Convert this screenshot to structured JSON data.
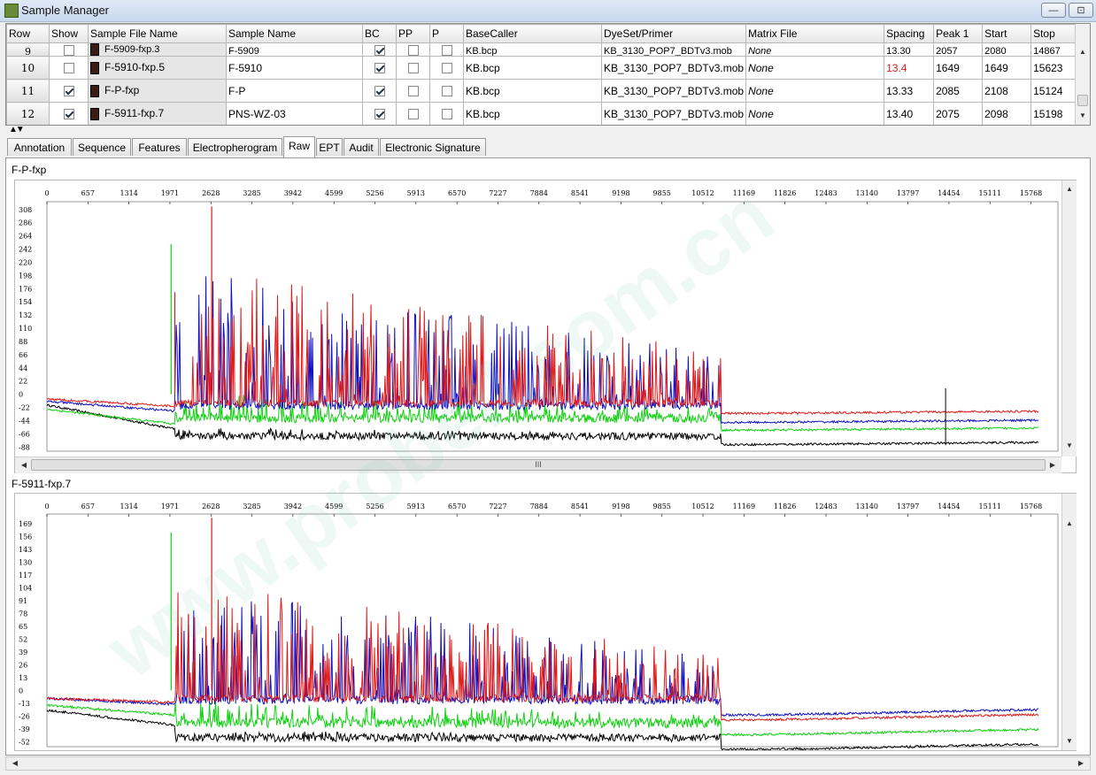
{
  "window": {
    "title": "Sample Manager",
    "min_glyph": "—",
    "max_glyph": "⊡"
  },
  "grid": {
    "headers": [
      "Row",
      "Show",
      "Sample File Name",
      "Sample Name",
      "BC",
      "PP",
      "P",
      "BaseCaller",
      "DyeSet/Primer",
      "Matrix File",
      "Spacing",
      "Peak 1",
      "Start",
      "Stop"
    ],
    "rows": [
      {
        "row": "9",
        "show": false,
        "file": "F-5909-fxp.3",
        "sample": "F-5909",
        "bc": true,
        "pp": false,
        "p": false,
        "basecaller": "KB.bcp",
        "dyeset": "KB_3130_POP7_BDTv3.mob",
        "matrix": "None",
        "spacing": "13.30",
        "spacing_color": "#000000",
        "peak1": "2057",
        "start": "2080",
        "stop": "14867"
      },
      {
        "row": "10",
        "show": false,
        "file": "F-5910-fxp.5",
        "sample": "F-5910",
        "bc": true,
        "pp": false,
        "p": false,
        "basecaller": "KB.bcp",
        "dyeset": "KB_3130_POP7_BDTv3.mob",
        "matrix": "None",
        "spacing": "13.4",
        "spacing_color": "#d42020",
        "peak1": "1649",
        "start": "1649",
        "stop": "15623"
      },
      {
        "row": "11",
        "show": true,
        "file": "F-P-fxp",
        "sample": "F-P",
        "bc": true,
        "pp": false,
        "p": false,
        "basecaller": "KB.bcp",
        "dyeset": "KB_3130_POP7_BDTv3.mob",
        "matrix": "None",
        "spacing": "13.33",
        "spacing_color": "#000000",
        "peak1": "2085",
        "start": "2108",
        "stop": "15124"
      },
      {
        "row": "12",
        "show": true,
        "file": "F-5911-fxp.7",
        "sample": "PNS-WZ-03",
        "bc": true,
        "pp": false,
        "p": false,
        "basecaller": "KB.bcp",
        "dyeset": "KB_3130_POP7_BDTv3.mob",
        "matrix": "None",
        "spacing": "13.40",
        "spacing_color": "#000000",
        "peak1": "2075",
        "start": "2098",
        "stop": "15198"
      }
    ]
  },
  "tabs": [
    "Annotation",
    "Sequence",
    "Features",
    "Electropherogram",
    "Raw",
    "EPT",
    "Audit",
    "Electronic Signature"
  ],
  "active_tab": "Raw",
  "scroll_labels": {
    "mid_thumb": "III"
  },
  "watermark_text": "www.probell.com.cn",
  "panels": [
    {
      "title": "F-P-fxp",
      "x_ticks": [
        0,
        657,
        1314,
        1971,
        2628,
        3285,
        3942,
        4599,
        5256,
        5913,
        6570,
        7227,
        7884,
        8541,
        9198,
        9855,
        10512,
        11169,
        11826,
        12483,
        13140,
        13797,
        14454,
        15111,
        15768
      ],
      "y_ticks": [
        308,
        286,
        264,
        242,
        220,
        198,
        176,
        154,
        132,
        110,
        88,
        66,
        44,
        22,
        0,
        -22,
        -44,
        -66,
        -88
      ],
      "y_range": [
        -95,
        318
      ]
    },
    {
      "title": "F-5911-fxp.7",
      "x_ticks": [
        0,
        657,
        1314,
        1971,
        2628,
        3285,
        3942,
        4599,
        5256,
        5913,
        6570,
        7227,
        7884,
        8541,
        9198,
        9855,
        10512,
        11169,
        11826,
        12483,
        13140,
        13797,
        14454,
        15111,
        15768
      ],
      "y_ticks": [
        169,
        156,
        143,
        130,
        117,
        104,
        91,
        78,
        65,
        52,
        39,
        26,
        13,
        0,
        -13,
        -26,
        -39,
        -52
      ],
      "y_range": [
        -57,
        177
      ]
    }
  ],
  "colors": {
    "red": "#e01818",
    "blue": "#1010c0",
    "green": "#10d010",
    "black": "#000000",
    "watermark": "#7fc6b4"
  }
}
